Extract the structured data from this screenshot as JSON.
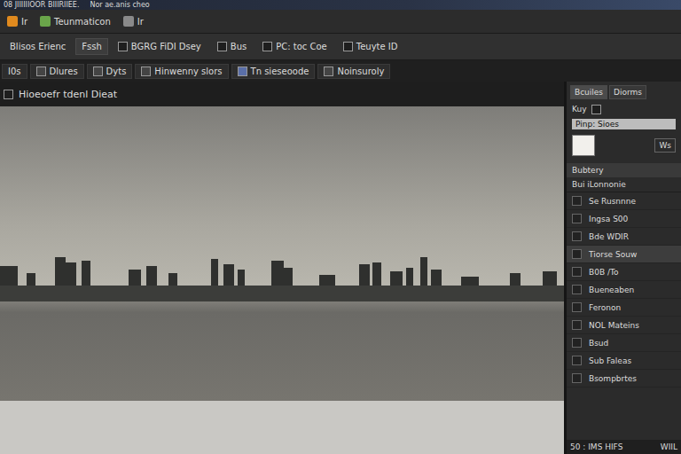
{
  "window": {
    "title": "08 JIIIIIIOOR BIIIRIIEE.",
    "subtitle": "Nor ae.anis cheo"
  },
  "toolbar": [
    {
      "label": "Ir"
    },
    {
      "label": "Teunmaticon"
    },
    {
      "label": "Ir"
    }
  ],
  "menu": [
    {
      "label": "Blisos Erienc",
      "selected": false
    },
    {
      "label": "Fssh",
      "selected": true
    },
    {
      "label": "BGRG FiDI Dsey",
      "selected": false
    },
    {
      "label": "Bus",
      "selected": false
    },
    {
      "label": "PC: toc Coe",
      "selected": false
    },
    {
      "label": "Teuyte ID",
      "selected": false
    }
  ],
  "tabbar": {
    "lead": "I0s",
    "tabs": [
      {
        "label": "Dlures",
        "selected": false
      },
      {
        "label": "Dyts",
        "selected": false
      },
      {
        "label": "Hinwenny slors",
        "selected": false
      },
      {
        "label": "Tn sieseoode",
        "selected": false
      },
      {
        "label": "Noinsuroly",
        "selected": false
      }
    ]
  },
  "document": {
    "title": "Hioeoefr tdenl Dieat"
  },
  "panel": {
    "tabs": [
      {
        "label": "Bcuiles",
        "selected": true
      },
      {
        "label": "Diorms",
        "selected": false
      }
    ],
    "label": "Kuy",
    "field": "Pinp: Sioes",
    "swatch_label": "Ws",
    "section": "Bubtery",
    "subsection": "Bui iLonnonie",
    "items": [
      {
        "label": "Se Rusnnne",
        "selected": false
      },
      {
        "label": "Ingsa S00",
        "selected": false
      },
      {
        "label": "Bde WDIR",
        "selected": false
      },
      {
        "label": "Tiorse Souw",
        "selected": true
      },
      {
        "label": "B0B /To",
        "selected": false
      },
      {
        "label": "Bueneaben",
        "selected": false
      },
      {
        "label": "Feronon",
        "selected": false
      },
      {
        "label": "NOL Mateins",
        "selected": false
      },
      {
        "label": "Bsud",
        "selected": false
      },
      {
        "label": "Sub Faleas",
        "selected": false
      },
      {
        "label": "Bsompbrtes",
        "selected": false
      }
    ],
    "footer": [
      "50 : IMS HIFS",
      "WIIL"
    ]
  }
}
